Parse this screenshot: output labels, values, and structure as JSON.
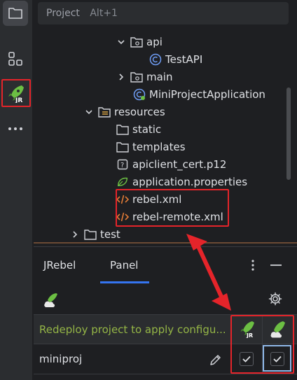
{
  "sidebar": {
    "buttons": [
      {
        "name": "project",
        "icon": "folder-icon"
      },
      {
        "name": "structure",
        "icon": "structure-icon"
      },
      {
        "name": "jrebel",
        "icon": "jrebel-rocket-icon",
        "badge": "JR"
      },
      {
        "name": "more",
        "icon": "more-horizontal-icon"
      }
    ]
  },
  "tree": {
    "header": {
      "title": "Project",
      "shortcut": "Alt+1"
    },
    "items": [
      {
        "label": "api",
        "icon": "package-folder-icon",
        "expanded": true
      },
      {
        "label": "TestAPI",
        "icon": "class-icon"
      },
      {
        "label": "main",
        "icon": "package-folder-icon",
        "expanded": false
      },
      {
        "label": "MiniProjectApplication",
        "icon": "spring-class-icon"
      },
      {
        "label": "resources",
        "icon": "resources-folder-icon",
        "expanded": true
      },
      {
        "label": "static",
        "icon": "folder-icon"
      },
      {
        "label": "templates",
        "icon": "folder-icon"
      },
      {
        "label": "apiclient_cert.p12",
        "icon": "unknown-file-icon"
      },
      {
        "label": "application.properties",
        "icon": "spring-properties-icon"
      },
      {
        "label": "rebel.xml",
        "icon": "xml-file-icon"
      },
      {
        "label": "rebel-remote.xml",
        "icon": "xml-file-icon"
      },
      {
        "label": "test",
        "icon": "folder-icon",
        "expanded": false
      }
    ]
  },
  "jrebel_panel": {
    "title": "JRebel",
    "tabs": [
      {
        "label": "Panel",
        "selected": true
      }
    ],
    "message": "Redeploy project to apply configu...",
    "project_name": "miniproj",
    "columns": [
      {
        "icon": "jrebel-rocket-icon",
        "checked": true
      },
      {
        "icon": "jrebel-remote-icon",
        "checked": true
      }
    ]
  },
  "colors": {
    "background": "#1e1f22",
    "panel": "#2b2d30",
    "accent_blue": "#3574f0",
    "message_green": "#94b546",
    "highlight_red": "#e5242a",
    "jrebel_green": "#6cbf43"
  }
}
